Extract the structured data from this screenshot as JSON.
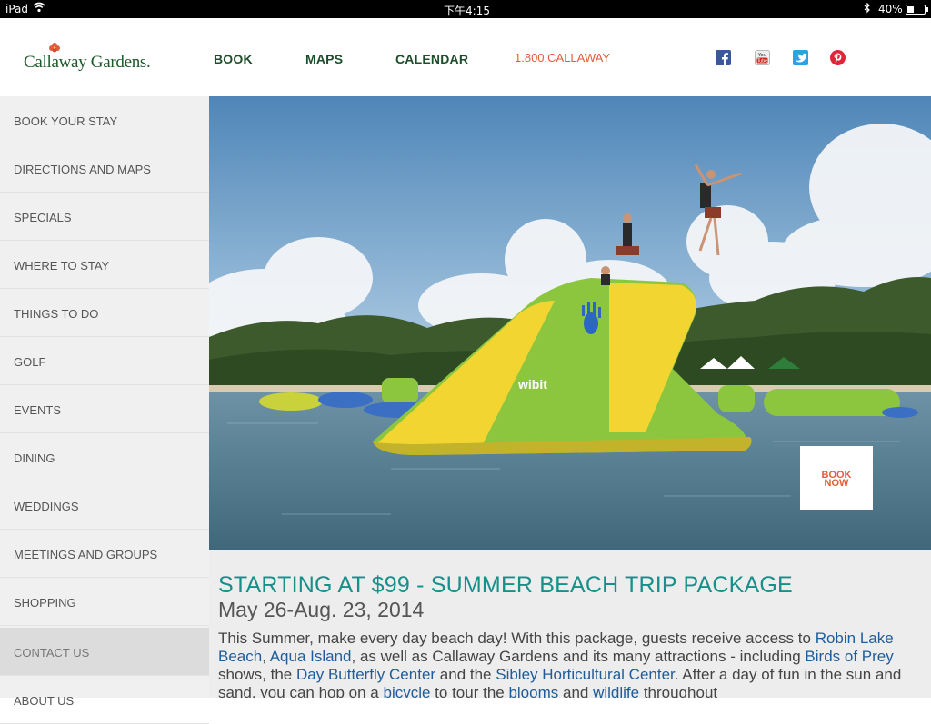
{
  "status_bar": {
    "device": "iPad",
    "time": "下午4:15",
    "battery": "40%",
    "battery_level": 0.4
  },
  "header": {
    "logo_text": "Callaway Gardens.",
    "nav": {
      "book": "BOOK",
      "maps": "MAPS",
      "calendar": "CALENDAR"
    },
    "phone": "1.800.CALLAWAY",
    "social_icons": [
      "facebook-icon",
      "youtube-icon",
      "twitter-icon",
      "pinterest-icon"
    ]
  },
  "sidebar": {
    "items": [
      {
        "label": "BOOK YOUR STAY"
      },
      {
        "label": "DIRECTIONS AND MAPS"
      },
      {
        "label": "SPECIALS"
      },
      {
        "label": "WHERE TO STAY"
      },
      {
        "label": "THINGS TO DO"
      },
      {
        "label": "GOLF"
      },
      {
        "label": "EVENTS"
      },
      {
        "label": "DINING"
      },
      {
        "label": "WEDDINGS"
      },
      {
        "label": "MEETINGS AND GROUPS"
      },
      {
        "label": "SHOPPING"
      },
      {
        "label": "CONTACT US"
      },
      {
        "label": "ABOUT US"
      }
    ]
  },
  "hero": {
    "float_brand": "wibit",
    "book_now_line1": "BOOK",
    "book_now_line2": "NOW"
  },
  "content": {
    "headline": "STARTING AT $99 - SUMMER BEACH TRIP PACKAGE",
    "dates": "May 26-Aug. 23, 2014",
    "body": {
      "t1": "This Summer, make every day beach day! With this package, guests receive access to ",
      "l1": "Robin Lake Beach",
      "t2": ", ",
      "l2": "Aqua Island",
      "t3": ", as well as Callaway Gardens and its many attractions - including ",
      "l3": "Birds of Prey",
      "t4": " shows, the ",
      "l4": "Day Butterfly Center",
      "t5": " and the ",
      "l5": "Sibley Horticultural Center",
      "t6": ". After a day of fun in the sun and sand, you can hop on a ",
      "l6": "bicycle",
      "t7": " to tour the ",
      "l7": "blooms",
      "t8": " and ",
      "l8": "wildlife",
      "t9": " throughout"
    }
  },
  "colors": {
    "accent_teal": "#18908a",
    "accent_orange": "#e25b3c",
    "nav_green": "#1d4d2a",
    "link_blue": "#1f5c99"
  }
}
